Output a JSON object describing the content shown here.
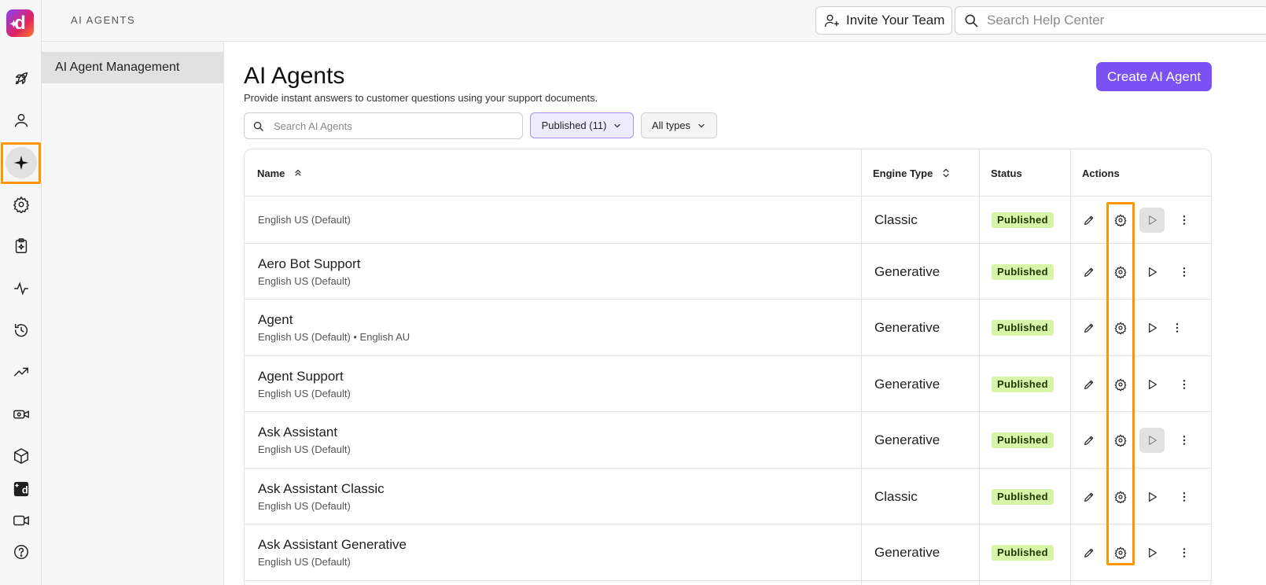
{
  "topbar": {
    "breadcrumb": "AI AGENTS",
    "invite_label": "Invite Your Team",
    "help_search_placeholder": "Search Help Center"
  },
  "rail": {
    "logo_letter": "d",
    "items": [
      "rocket-icon",
      "person-icon",
      "ai-sparkle-icon",
      "gear-icon",
      "clipboard-sparkle-icon",
      "activity-icon",
      "history-icon",
      "trending-icon",
      "video-gear-icon",
      "cube-icon",
      "d-logo-icon",
      "video-icon",
      "help-icon"
    ],
    "active_item": "ai-sparkle-icon"
  },
  "subnav": {
    "items": [
      "AI Agent Management"
    ]
  },
  "main": {
    "title": "AI Agents",
    "subtitle": "Provide instant answers to customer questions using your support documents.",
    "create_label": "Create AI Agent",
    "search_placeholder": "Search AI Agents",
    "filter_published": "Published (11)",
    "filter_types": "All types"
  },
  "table": {
    "headers": {
      "name": "Name",
      "engine": "Engine Type",
      "status": "Status",
      "actions": "Actions"
    },
    "rows": [
      {
        "name": "",
        "languages": "English US (Default)",
        "engine": "Classic",
        "status": "Published",
        "play_disabled": true
      },
      {
        "name": "Aero Bot Support",
        "languages": "English US (Default)",
        "engine": "Generative",
        "status": "Published",
        "play_disabled": false
      },
      {
        "name": "Agent",
        "languages": "English US (Default) • English AU",
        "engine": "Generative",
        "status": "Published",
        "play_disabled": false
      },
      {
        "name": "Agent Support",
        "languages": "English US (Default)",
        "engine": "Generative",
        "status": "Published",
        "play_disabled": false
      },
      {
        "name": "Ask Assistant",
        "languages": "English US (Default)",
        "engine": "Generative",
        "status": "Published",
        "play_disabled": true
      },
      {
        "name": "Ask Assistant Classic",
        "languages": "English US (Default)",
        "engine": "Classic",
        "status": "Published",
        "play_disabled": false
      },
      {
        "name": "Ask Assistant Generative",
        "languages": "English US (Default)",
        "engine": "Generative",
        "status": "Published",
        "play_disabled": false
      }
    ]
  },
  "colors": {
    "accent": "#7a52f4",
    "highlight": "#ff9500",
    "badge_bg": "#d6f5a8"
  }
}
